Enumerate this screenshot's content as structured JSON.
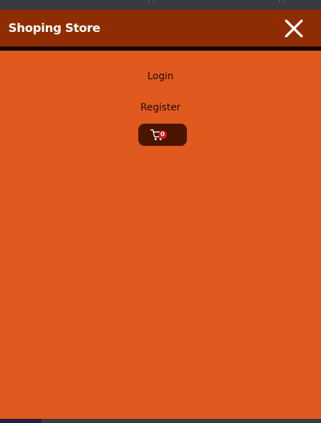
{
  "header": {
    "title": "Shoping Store",
    "close_icon": "close-icon",
    "background_color": "#8e2d03"
  },
  "menu": {
    "items": [
      {
        "label": "Login"
      },
      {
        "label": "Register"
      }
    ],
    "cart": {
      "icon": "cart-icon",
      "count": "0"
    },
    "background_color": "#e05a1f"
  }
}
